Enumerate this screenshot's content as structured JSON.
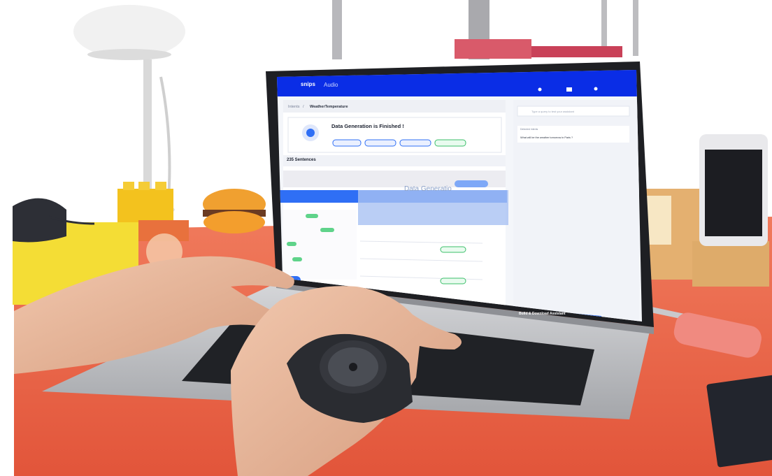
{
  "app": {
    "brand": "snips",
    "project_menu": "Audio"
  },
  "breadcrumb": {
    "root": "Intents",
    "separator": "/",
    "current": "WeatherTemperature"
  },
  "generation": {
    "status_title": "Data Generation is Finished !"
  },
  "sentences": {
    "header": "235 Sentences"
  },
  "overlay": {
    "watermark": "Data Generatio"
  },
  "right_panel": {
    "search_placeholder": "Type a query to test your assistant",
    "query_header": "Detected intents",
    "query_text": "What will be the weather tomorrow in Paris ?"
  },
  "actions": {
    "build_button": "Build & Download Assistant"
  },
  "colors": {
    "brand_blue": "#0a2de6",
    "accent_blue": "#2f6ff5",
    "desk": "#e65c3f",
    "wall": "#ffffff"
  }
}
